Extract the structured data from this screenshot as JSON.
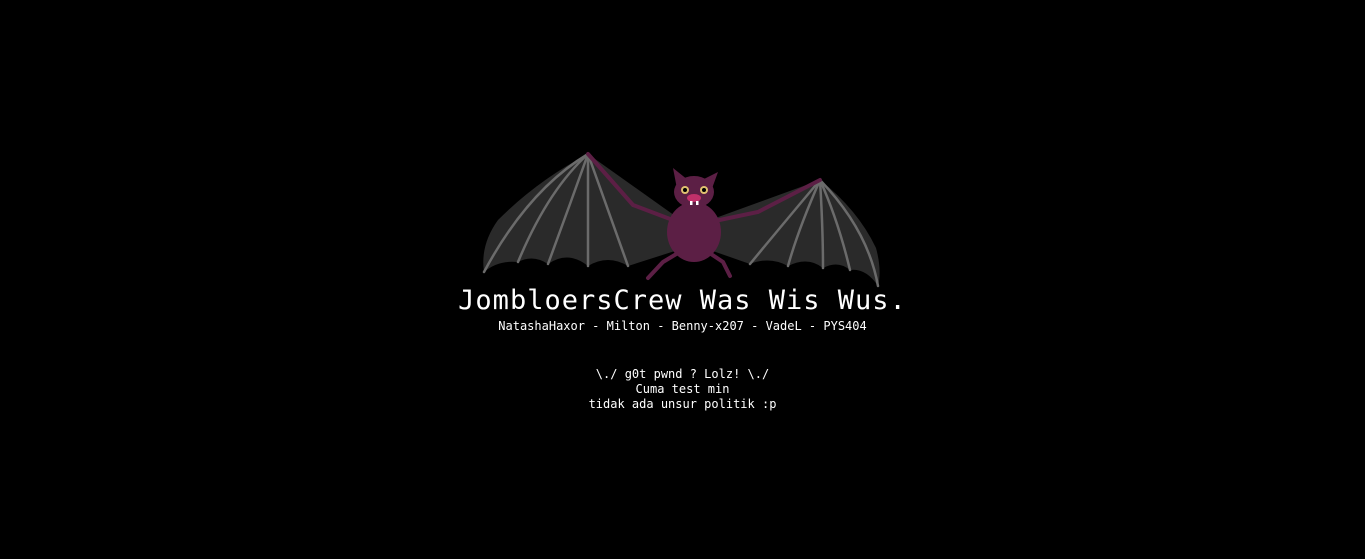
{
  "page": {
    "headline": "JombloersCrew Was Wis Wus.",
    "members": "NatashaHaxor - Milton - Benny-x207 - VadeL - PYS404",
    "message_lines": [
      "\\./ g0t pwnd ? Lolz! \\./",
      "Cuma test min",
      "tidak ada unsur politik :p"
    ]
  },
  "colors": {
    "background": "#000000",
    "text": "#ffffff",
    "bat_body": "#5c1f45",
    "bat_wing": "#2a2a2a",
    "bat_wing_bone": "#6b6b6b"
  },
  "icons": {
    "logo": "bat-icon"
  }
}
